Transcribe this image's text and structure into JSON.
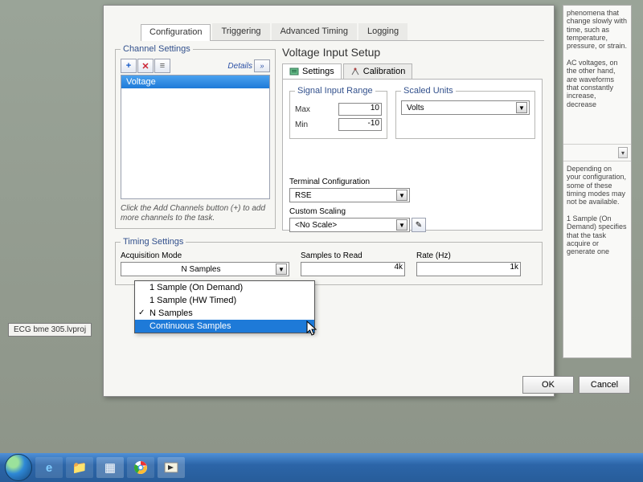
{
  "file_tag": "ECG bme 305.lvproj",
  "tabs": [
    "Configuration",
    "Triggering",
    "Advanced Timing",
    "Logging"
  ],
  "channel_settings": {
    "legend": "Channel Settings",
    "details_label": "Details",
    "selected_channel": "Voltage",
    "hint": "Click the Add Channels button (+) to add more channels to the task."
  },
  "setup": {
    "title": "Voltage Input Setup",
    "subtabs": {
      "settings": "Settings",
      "calibration": "Calibration"
    },
    "signal_range": {
      "legend": "Signal Input Range",
      "max_label": "Max",
      "max_value": "10",
      "min_label": "Min",
      "min_value": "-10"
    },
    "scaled_units": {
      "legend": "Scaled Units",
      "value": "Volts"
    },
    "terminal": {
      "label": "Terminal Configuration",
      "value": "RSE"
    },
    "custom_scaling": {
      "label": "Custom Scaling",
      "value": "<No Scale>"
    }
  },
  "timing": {
    "legend": "Timing Settings",
    "acq_label": "Acquisition Mode",
    "acq_value": "N Samples",
    "acq_options": [
      "1 Sample (On Demand)",
      "1 Sample (HW Timed)",
      "N Samples",
      "Continuous Samples"
    ],
    "samples_label": "Samples to Read",
    "samples_value": "4k",
    "rate_label": "Rate (Hz)",
    "rate_value": "1k"
  },
  "help": {
    "top_text": "phenomena that change slowly with time, such as temperature, pressure, or strain.\n\nAC voltages, on the other hand, are waveforms that constantly increase, decrease",
    "bot_text": "Depending on your configuration, some of these timing modes may not be available.\n\n1 Sample (On Demand) specifies that the task acquire or generate one"
  },
  "buttons": {
    "ok": "OK",
    "cancel": "Cancel"
  },
  "colors": {
    "accent": "#1e7ad8"
  }
}
